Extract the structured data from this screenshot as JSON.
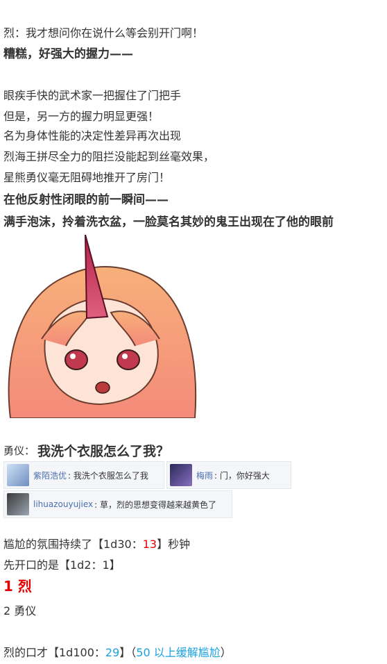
{
  "lines": {
    "l1": "烈：我才想问你在说什么等会别开门啊！",
    "l2": "糟糕，好强大的握力——",
    "l3": "眼疾手快的武术家一把握住了门把手",
    "l4": "但是，另一方的握力明显更强！",
    "l5": "名为身体性能的决定性差异再次出现",
    "l6": "烈海王拼尽全力的阻拦没能起到丝毫效果，",
    "l7": "星熊勇仪毫无阻碍地推开了房门！",
    "l8": "在他反射性闭眼的前一瞬间——",
    "l9": "满手泡沫，拎着洗衣盆，一脸莫名其妙的鬼王出现在了他的眼前"
  },
  "dialogue": {
    "speaker": "勇仪：",
    "text": "我洗个衣服怎么了我？"
  },
  "comments": [
    {
      "user": "紫陌浩优",
      "text": ": 我洗个衣服怎么了我"
    },
    {
      "user": "梅雨",
      "text": ": 门，你好强大"
    },
    {
      "user": "lihuazouyujiex",
      "text": ": 草，烈的思想变得越来越黄色了"
    }
  ],
  "rolls": {
    "r1_pre": "尴尬的氛围持续了【1d30：",
    "r1_val": "13",
    "r1_post": "】秒钟",
    "r2": "先开口的是【1d2：1】",
    "opt1": "1  烈",
    "opt2": "2  勇仪",
    "r3_pre": "烈的口才【1d100：",
    "r3_val": "29",
    "r3_mid": "】（",
    "r3_note": "50 以上缓解尴尬",
    "r3_post": "）"
  },
  "colors": {
    "roll_value": "#e60000",
    "link": "#1aa2e0",
    "username": "#4a6fb0"
  }
}
